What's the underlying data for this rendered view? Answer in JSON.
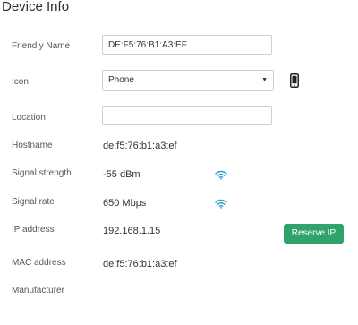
{
  "header": {
    "title": "Device Info"
  },
  "fields": {
    "friendly_name": {
      "label": "Friendly Name",
      "value": "DE:F5:76:B1:A3:EF"
    },
    "icon": {
      "label": "Icon",
      "selected": "Phone",
      "icon_name": "phone-icon"
    },
    "location": {
      "label": "Location",
      "value": ""
    },
    "hostname": {
      "label": "Hostname",
      "value": "de:f5:76:b1:a3:ef"
    },
    "signal_strength": {
      "label": "Signal strength",
      "value": "-55 dBm",
      "icon_name": "wifi-icon"
    },
    "signal_rate": {
      "label": "Signal rate",
      "value": "650 Mbps",
      "icon_name": "wifi-icon"
    },
    "ip_address": {
      "label": "IP address",
      "value": "192.168.1.15",
      "action_label": "Reserve IP"
    },
    "mac_address": {
      "label": "MAC address",
      "value": "de:f5:76:b1:a3:ef"
    },
    "manufacturer": {
      "label": "Manufacturer",
      "value": ""
    }
  },
  "colors": {
    "accent": "#2fa36b",
    "wifi": "#2a9fd6"
  }
}
